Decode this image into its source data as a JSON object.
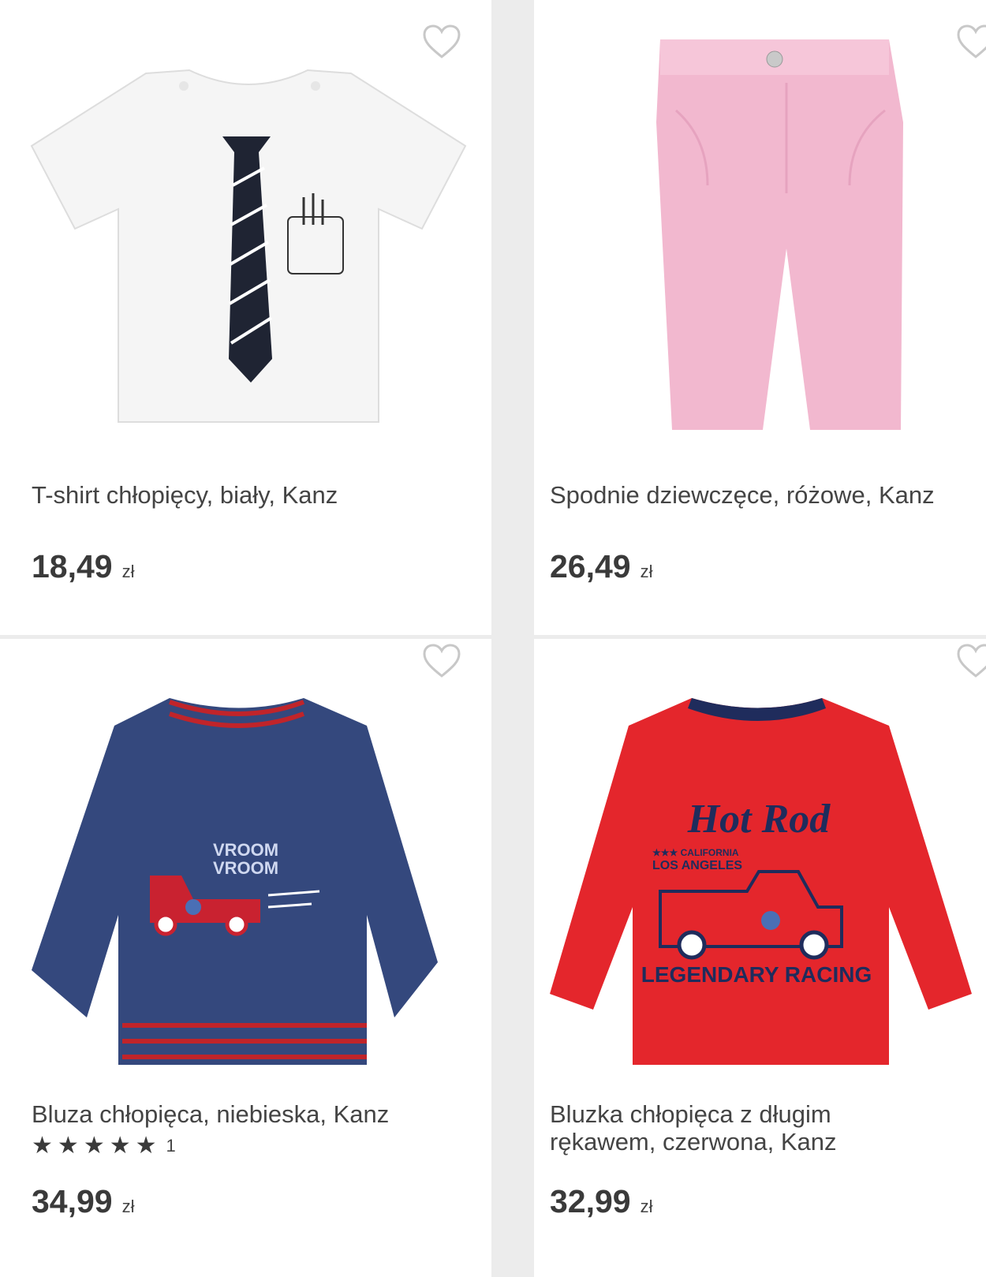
{
  "currency": "zł",
  "products": [
    {
      "title": "T-shirt chłopięcy, biały, Kanz",
      "price": "18,49",
      "image_alt": "T-shirt"
    },
    {
      "title": "Spodnie dziewczęce, różowe, Kanz",
      "price": "26,49",
      "image_alt": "Spodnie"
    },
    {
      "title": "Bluza chłopięca, niebieska, Kanz",
      "price": "34,99",
      "rating": 5,
      "rating_count": "1",
      "image_alt": "Bluza"
    },
    {
      "title": "Bluzka chłopięca z długim\nrękawem, czerwona, Kanz",
      "price": "32,99",
      "image_alt": "Bluzka",
      "print_text": {
        "line1": "Hot Rod",
        "line2": "★★★ CALIFORNIA",
        "line3": "LOS ANGELES",
        "line4": "LEGENDARY RACING"
      }
    }
  ],
  "sweatshirt_print": {
    "line1": "VROOM",
    "line2": "VROOM"
  },
  "colors": {
    "heart_outline": "#c8c8c8",
    "text": "#3a3a3a",
    "background": "#ececec"
  }
}
